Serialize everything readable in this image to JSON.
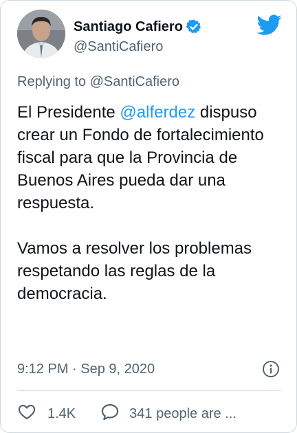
{
  "author": {
    "display_name": "Santiago Cafiero",
    "handle": "@SantiCafiero",
    "verified": true
  },
  "reply_context": {
    "prefix": "Replying to ",
    "target": "@SantiCafiero"
  },
  "tweet": {
    "p1_before": "El Presidente ",
    "mention": "@alferdez",
    "p1_after": " dispuso crear un Fondo de fortalecimiento fiscal para que la Provincia de Buenos Aires pueda dar una respuesta.",
    "p2": "Vamos a resolver los problemas respetando las reglas de la democracia."
  },
  "meta": {
    "timestamp": "9:12 PM · Sep 9, 2020"
  },
  "actions": {
    "like_count": "1.4K",
    "reply_text": "341 people are ..."
  },
  "icons": {
    "brand": "twitter-bird-icon",
    "verified": "verified-badge-icon",
    "info": "info-icon",
    "like": "heart-icon",
    "reply": "speech-bubble-icon"
  },
  "colors": {
    "accent": "#1d9bf0",
    "text_primary": "#0f1419",
    "text_secondary": "#536471",
    "border": "#cfd9de"
  }
}
